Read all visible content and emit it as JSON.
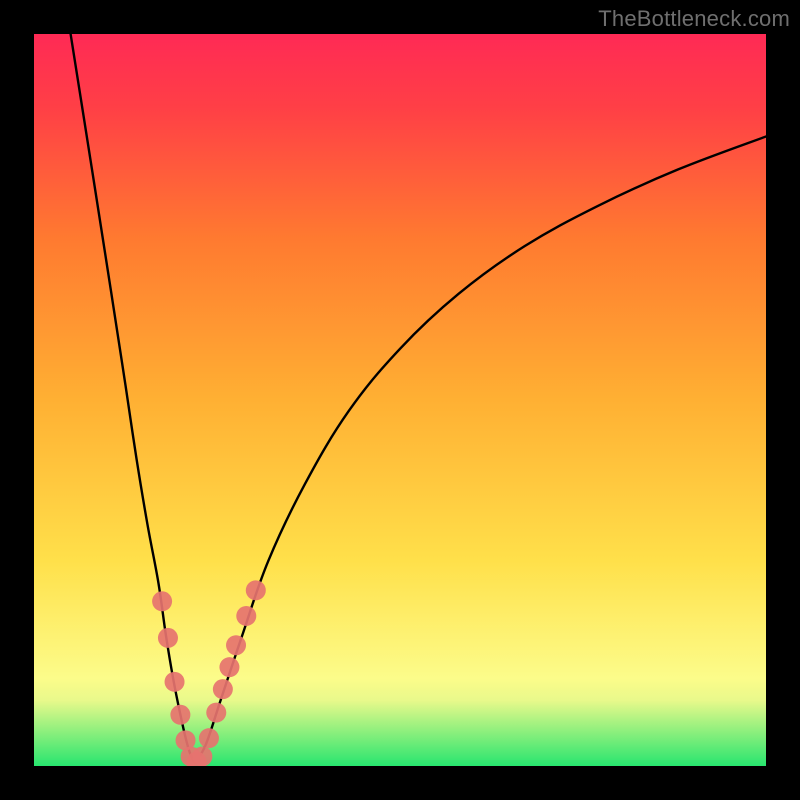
{
  "watermark": "TheBottleneck.com",
  "chart_data": {
    "type": "line",
    "title": "",
    "xlabel": "",
    "ylabel": "",
    "xlim": [
      0,
      100
    ],
    "ylim": [
      0,
      100
    ],
    "gradient_stops": [
      {
        "offset": 0,
        "color": "#28e56f"
      },
      {
        "offset": 0.05,
        "color": "#93f07e"
      },
      {
        "offset": 0.09,
        "color": "#e9f98b"
      },
      {
        "offset": 0.12,
        "color": "#fcfc8a"
      },
      {
        "offset": 0.28,
        "color": "#ffe04a"
      },
      {
        "offset": 0.5,
        "color": "#ffb033"
      },
      {
        "offset": 0.72,
        "color": "#ff7a30"
      },
      {
        "offset": 0.9,
        "color": "#ff3f46"
      },
      {
        "offset": 1.0,
        "color": "#ff2a55"
      }
    ],
    "series": [
      {
        "name": "left-branch",
        "x": [
          5.0,
          8.0,
          10.5,
          12.5,
          14.0,
          15.5,
          17.0,
          18.0,
          19.0,
          20.0,
          20.8,
          21.4,
          22.0
        ],
        "y": [
          100.0,
          81.0,
          65.0,
          52.0,
          42.0,
          33.0,
          25.0,
          18.0,
          12.0,
          7.0,
          3.5,
          1.5,
          0.4
        ]
      },
      {
        "name": "right-branch",
        "x": [
          22.0,
          23.5,
          25.5,
          28.5,
          32.0,
          37.0,
          43.0,
          50.0,
          58.0,
          67.0,
          77.0,
          88.0,
          100.0
        ],
        "y": [
          0.4,
          3.0,
          9.0,
          18.0,
          28.0,
          38.5,
          48.5,
          57.0,
          64.5,
          71.0,
          76.5,
          81.5,
          86.0
        ]
      }
    ],
    "markers": {
      "name": "highlight-points",
      "color": "#e6736f",
      "radius": 10,
      "points": [
        {
          "x": 17.5,
          "y": 22.5
        },
        {
          "x": 18.3,
          "y": 17.5
        },
        {
          "x": 19.2,
          "y": 11.5
        },
        {
          "x": 20.0,
          "y": 7.0
        },
        {
          "x": 20.7,
          "y": 3.5
        },
        {
          "x": 21.4,
          "y": 1.3
        },
        {
          "x": 22.2,
          "y": 0.6
        },
        {
          "x": 23.0,
          "y": 1.3
        },
        {
          "x": 23.9,
          "y": 3.8
        },
        {
          "x": 24.9,
          "y": 7.3
        },
        {
          "x": 25.8,
          "y": 10.5
        },
        {
          "x": 26.7,
          "y": 13.5
        },
        {
          "x": 27.6,
          "y": 16.5
        },
        {
          "x": 29.0,
          "y": 20.5
        },
        {
          "x": 30.3,
          "y": 24.0
        }
      ]
    },
    "valley_x": 22.0
  }
}
